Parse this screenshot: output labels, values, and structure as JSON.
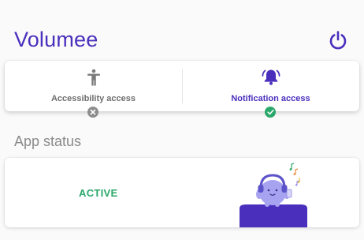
{
  "app": {
    "title": "Volumee",
    "power_icon": "power-icon"
  },
  "permissions": [
    {
      "label": "Accessibility access",
      "icon": "accessibility-icon",
      "granted": false,
      "status_icon": "close-icon"
    },
    {
      "label": "Notification access",
      "icon": "notification-bell-icon",
      "granted": true,
      "status_icon": "check-icon"
    }
  ],
  "app_status": {
    "section_title": "App status",
    "status": "ACTIVE",
    "illustration": "headphone-mascot-illustration"
  },
  "colors": {
    "brand": "#4a2fbd",
    "active": "#2aa86a",
    "inactive": "#8d8d8d",
    "muted_text": "#8a8a8a"
  }
}
